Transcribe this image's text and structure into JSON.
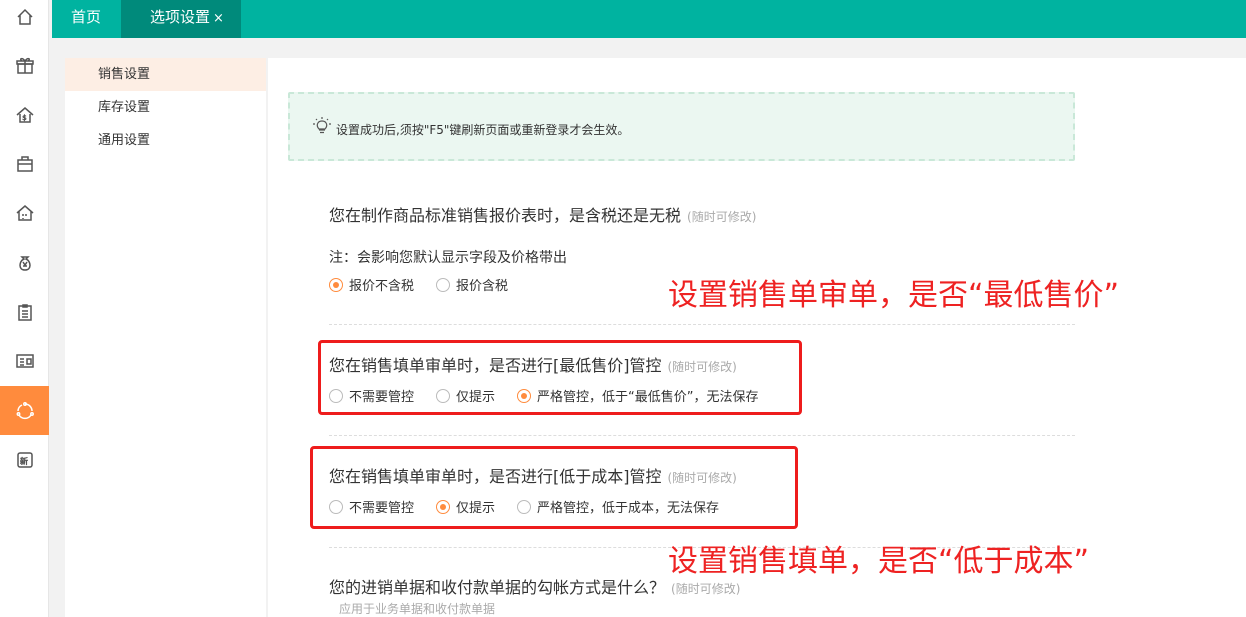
{
  "rail": {
    "icons": [
      "home-icon",
      "gift-icon",
      "money-house-icon",
      "bag-icon",
      "building-icon",
      "yuan-bag-icon",
      "clipboard-icon",
      "id-card-icon",
      "cycle-icon",
      "new-icon"
    ],
    "active_index": 8
  },
  "tabs": {
    "home": "首页",
    "active": "选项设置",
    "close": "×"
  },
  "submenu": [
    "销售设置",
    "库存设置",
    "通用设置"
  ],
  "notice": "设置成功后,须按\"F5\"键刷新页面或重新登录才会生效。",
  "q1": {
    "title": "您在制作商品标准销售报价表时，是含税还是无税",
    "hint": "(随时可修改)",
    "note": "注：会影响您默认显示字段及价格带出",
    "options": [
      "报价不含税",
      "报价含税"
    ],
    "selected": 0
  },
  "q2": {
    "title": "您在销售填单审单时，是否进行[最低售价]管控",
    "hint": "(随时可修改)",
    "options": [
      "不需要管控",
      "仅提示",
      "严格管控，低于“最低售价”，无法保存"
    ],
    "selected": 2
  },
  "q3": {
    "title": "您在销售填单审单时，是否进行[低于成本]管控",
    "hint": "(随时可修改)",
    "options": [
      "不需要管控",
      "仅提示",
      "严格管控，低于成本，无法保存"
    ],
    "selected": 1
  },
  "q4": {
    "title": "您的进销单据和收付款单据的勾帐方式是什么？",
    "hint": "(随时可修改)",
    "note": "应用于业务单据和收付款单据"
  },
  "annotations": {
    "a1": "设置销售单审单，是否“最低售价”",
    "a2": "设置销售填单，是否“低于成本”"
  },
  "colors": {
    "teal": "#00b3a0",
    "teal_dark": "#008a7b",
    "orange": "#ff8b3d",
    "red": "#ee1c1c"
  }
}
